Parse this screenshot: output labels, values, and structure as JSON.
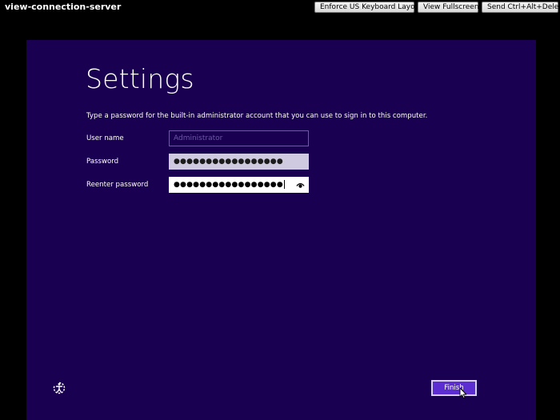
{
  "console": {
    "title": "view-connection-server",
    "buttons": {
      "keyboard": "Enforce US Keyboard Layout",
      "fullscreen": "View Fullscreen",
      "ctrl_alt_del": "Send Ctrl+Alt+Delete"
    }
  },
  "setup": {
    "title": "Settings",
    "instruction": "Type a password for the built-in administrator account that you can use to sign in to this computer.",
    "fields": {
      "user_name": {
        "label": "User name",
        "placeholder": "Administrator"
      },
      "password": {
        "label": "Password",
        "value": "●●●●●●●●●●●●●●●●●"
      },
      "reenter_password": {
        "label": "Reenter password",
        "value": "●●●●●●●●●●●●●●●●●"
      }
    },
    "finish_label": "Finish"
  },
  "colors": {
    "background": "#1a0050",
    "accent": "#5c2ed1",
    "console_background": "#000000"
  },
  "icons": {
    "reveal": "eye-icon",
    "ease_of_access": "ease-of-access-icon",
    "cursor": "mouse-cursor-icon"
  }
}
